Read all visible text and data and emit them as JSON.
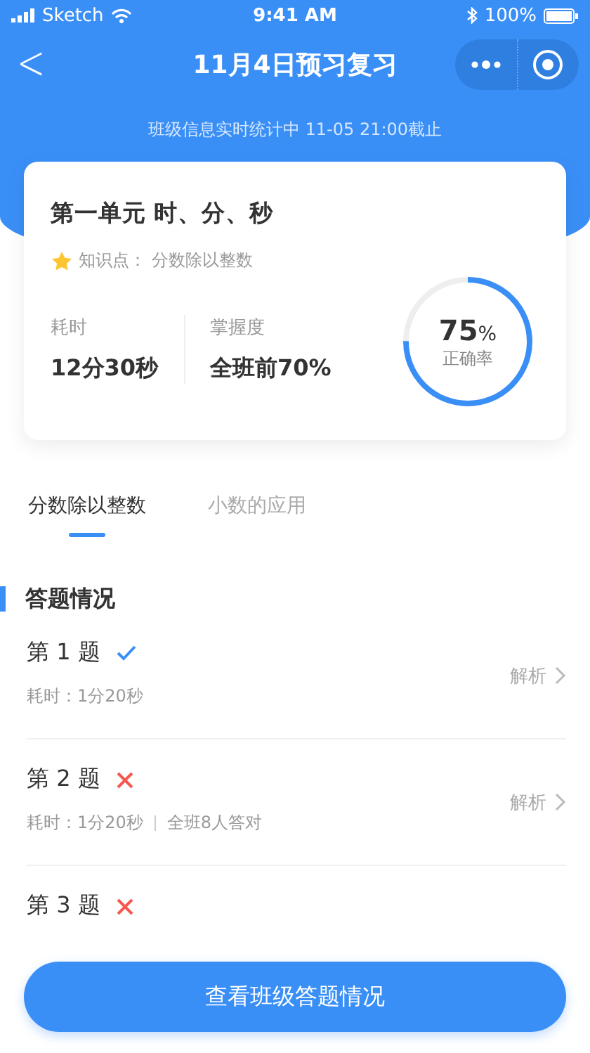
{
  "status_bar": {
    "carrier": "Sketch",
    "time": "9:41 AM",
    "battery": "100%"
  },
  "nav": {
    "back": "<",
    "title": "11月4日预习复习"
  },
  "subtitle": "班级信息实时统计中 11-05 21:00截止",
  "summary": {
    "unit": "第一单元 时、分、秒",
    "knowledge_label": "知识点：",
    "knowledge": "分数除以整数",
    "stats": [
      {
        "label": "耗时",
        "value": "12分30秒"
      },
      {
        "label": "掌握度",
        "value": "全班前70%"
      }
    ],
    "accuracy": {
      "value": "75",
      "unit": "%",
      "label": "正确率",
      "level": 0.75
    }
  },
  "tabs": [
    {
      "label": "分数除以整数",
      "selected": true
    },
    {
      "label": "小数的应用",
      "selected": false
    }
  ],
  "section_title": "答题情况",
  "questions": [
    {
      "number": "1",
      "prefix": "第",
      "suffix": "题",
      "correct": true,
      "meta": [
        "耗时：1分20秒"
      ],
      "action": "解析"
    },
    {
      "number": "2",
      "prefix": "第",
      "suffix": "题",
      "correct": false,
      "meta": [
        "耗时：1分20秒",
        "全班8人答对"
      ],
      "action": "解析"
    },
    {
      "number": "3",
      "prefix": "第",
      "suffix": "题",
      "correct": false
    }
  ],
  "footer_button": "查看班级答题情况"
}
